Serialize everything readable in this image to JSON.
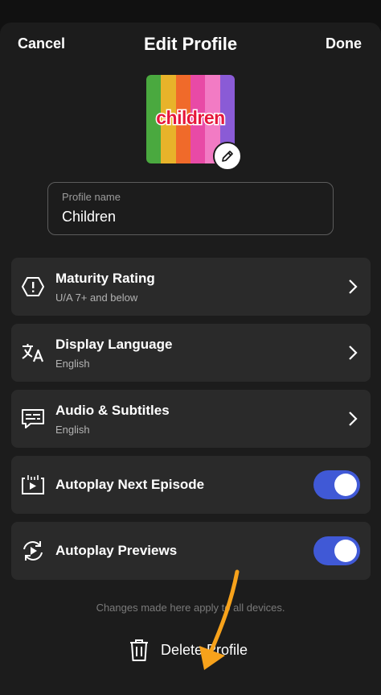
{
  "header": {
    "cancel_label": "Cancel",
    "title": "Edit Profile",
    "done_label": "Done"
  },
  "avatar": {
    "text": "children",
    "stripe_colors": [
      "#4aa93f",
      "#e8b32a",
      "#f06a2a",
      "#e84aa6",
      "#f27bc4",
      "#8a5bd6"
    ],
    "edit_icon": "pencil-icon"
  },
  "profile_name": {
    "label": "Profile name",
    "value": "Children"
  },
  "settings": [
    {
      "icon": "maturity-warning-icon",
      "title": "Maturity Rating",
      "subtitle": "U/A 7+ and below"
    },
    {
      "icon": "language-icon",
      "title": "Display Language",
      "subtitle": "English"
    },
    {
      "icon": "subtitles-icon",
      "title": "Audio & Subtitles",
      "subtitle": "English"
    }
  ],
  "toggles": [
    {
      "icon": "autoplay-next-icon",
      "title": "Autoplay Next Episode",
      "on": true
    },
    {
      "icon": "autoplay-previews-icon",
      "title": "Autoplay Previews",
      "on": true
    }
  ],
  "footer": {
    "note": "Changes made here apply to all devices.",
    "delete_label": "Delete Profile",
    "delete_icon": "trash-icon"
  },
  "colors": {
    "background": "#1c1c1c",
    "row_background": "#2a2a2a",
    "toggle_on": "#4059d6",
    "annotation_arrow": "#f7a21b"
  }
}
